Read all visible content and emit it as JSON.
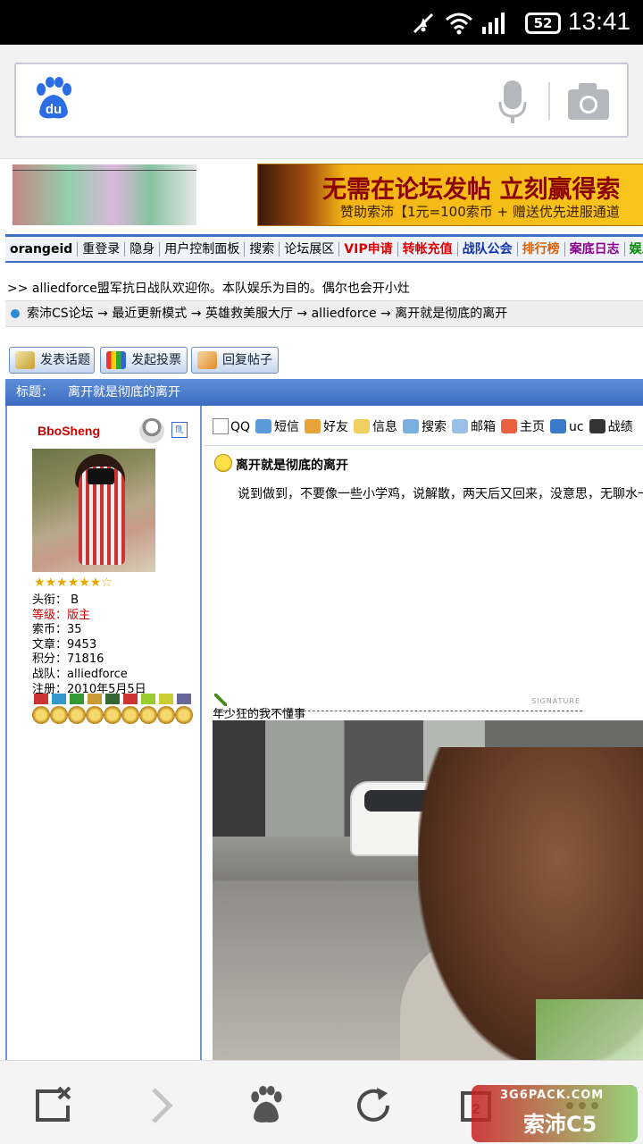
{
  "status": {
    "time": "13:41",
    "battery": "52"
  },
  "browser": {
    "logo_text": "du"
  },
  "banner_ad": {
    "line1": "无需在论坛发帖 立刻赢得索",
    "line2_prefix": "赞助索沛【1元=100索币 + 赠送优先进服通道",
    "line2_end": ""
  },
  "nav": {
    "items": [
      {
        "label": "orangeid",
        "style": "n0"
      },
      {
        "label": "重登录",
        "style": ""
      },
      {
        "label": "隐身",
        "style": ""
      },
      {
        "label": "用户控制面板",
        "style": ""
      },
      {
        "label": "搜索",
        "style": ""
      },
      {
        "label": "论坛展区",
        "style": ""
      },
      {
        "label": "VIP申请",
        "style": "red"
      },
      {
        "label": "转帐充值",
        "style": "red"
      },
      {
        "label": "战队公会",
        "style": "blue"
      },
      {
        "label": "排行榜",
        "style": "orange"
      },
      {
        "label": "案底日志",
        "style": "purple"
      },
      {
        "label": "娱乐指",
        "style": "green"
      }
    ]
  },
  "welcome": ">> alliedforce盟军抗日战队欢迎你。本队娱乐为目的。偶尔也会开小灶",
  "breadcrumb": [
    "索沛CS论坛",
    "最近更新模式",
    "英雄救美服大厅",
    "alliedforce",
    "离开就是彻底的离开"
  ],
  "actions": {
    "post": "发表话题",
    "poll": "发起投票",
    "reply": "回复帖子"
  },
  "topic": {
    "label": "标题：",
    "title": "离开就是彻底的离开"
  },
  "user": {
    "name": "BboSheng",
    "sex": "♏",
    "stars": "★★★★★★☆",
    "rows": [
      {
        "k": "头衔：",
        "v": " B",
        "red": false
      },
      {
        "k": "等级：",
        "v": "版主",
        "red": true
      },
      {
        "k": "索币：",
        "v": "35",
        "red": false
      },
      {
        "k": "文章：",
        "v": "9453",
        "red": false
      },
      {
        "k": "积分：",
        "v": "71816",
        "red": false
      },
      {
        "k": "战队：",
        "v": "alliedforce",
        "red": false
      },
      {
        "k": "注册：",
        "v": "2010年5月5日",
        "red": false
      }
    ]
  },
  "post_toolbar": [
    "QQ",
    "短信",
    "好友",
    "信息",
    "搜索",
    "邮箱",
    "主页",
    "uc",
    "战绩"
  ],
  "post": {
    "title": "离开就是彻底的离开",
    "body": "说到做到，不要像一些小学鸡，说解散，两天后又回来，没意思，无聊水一",
    "signature_label": "SIGNATURE",
    "signature_caption": "年少狂的我不懂事"
  },
  "watermark": {
    "top": "3G6PACK.COM",
    "main": "索沛C5"
  },
  "colors": {
    "accent": "#3c6cc0",
    "title_bar": "#4a7bd0",
    "red": "#cc0000",
    "baidu_blue": "#2b6de5"
  }
}
